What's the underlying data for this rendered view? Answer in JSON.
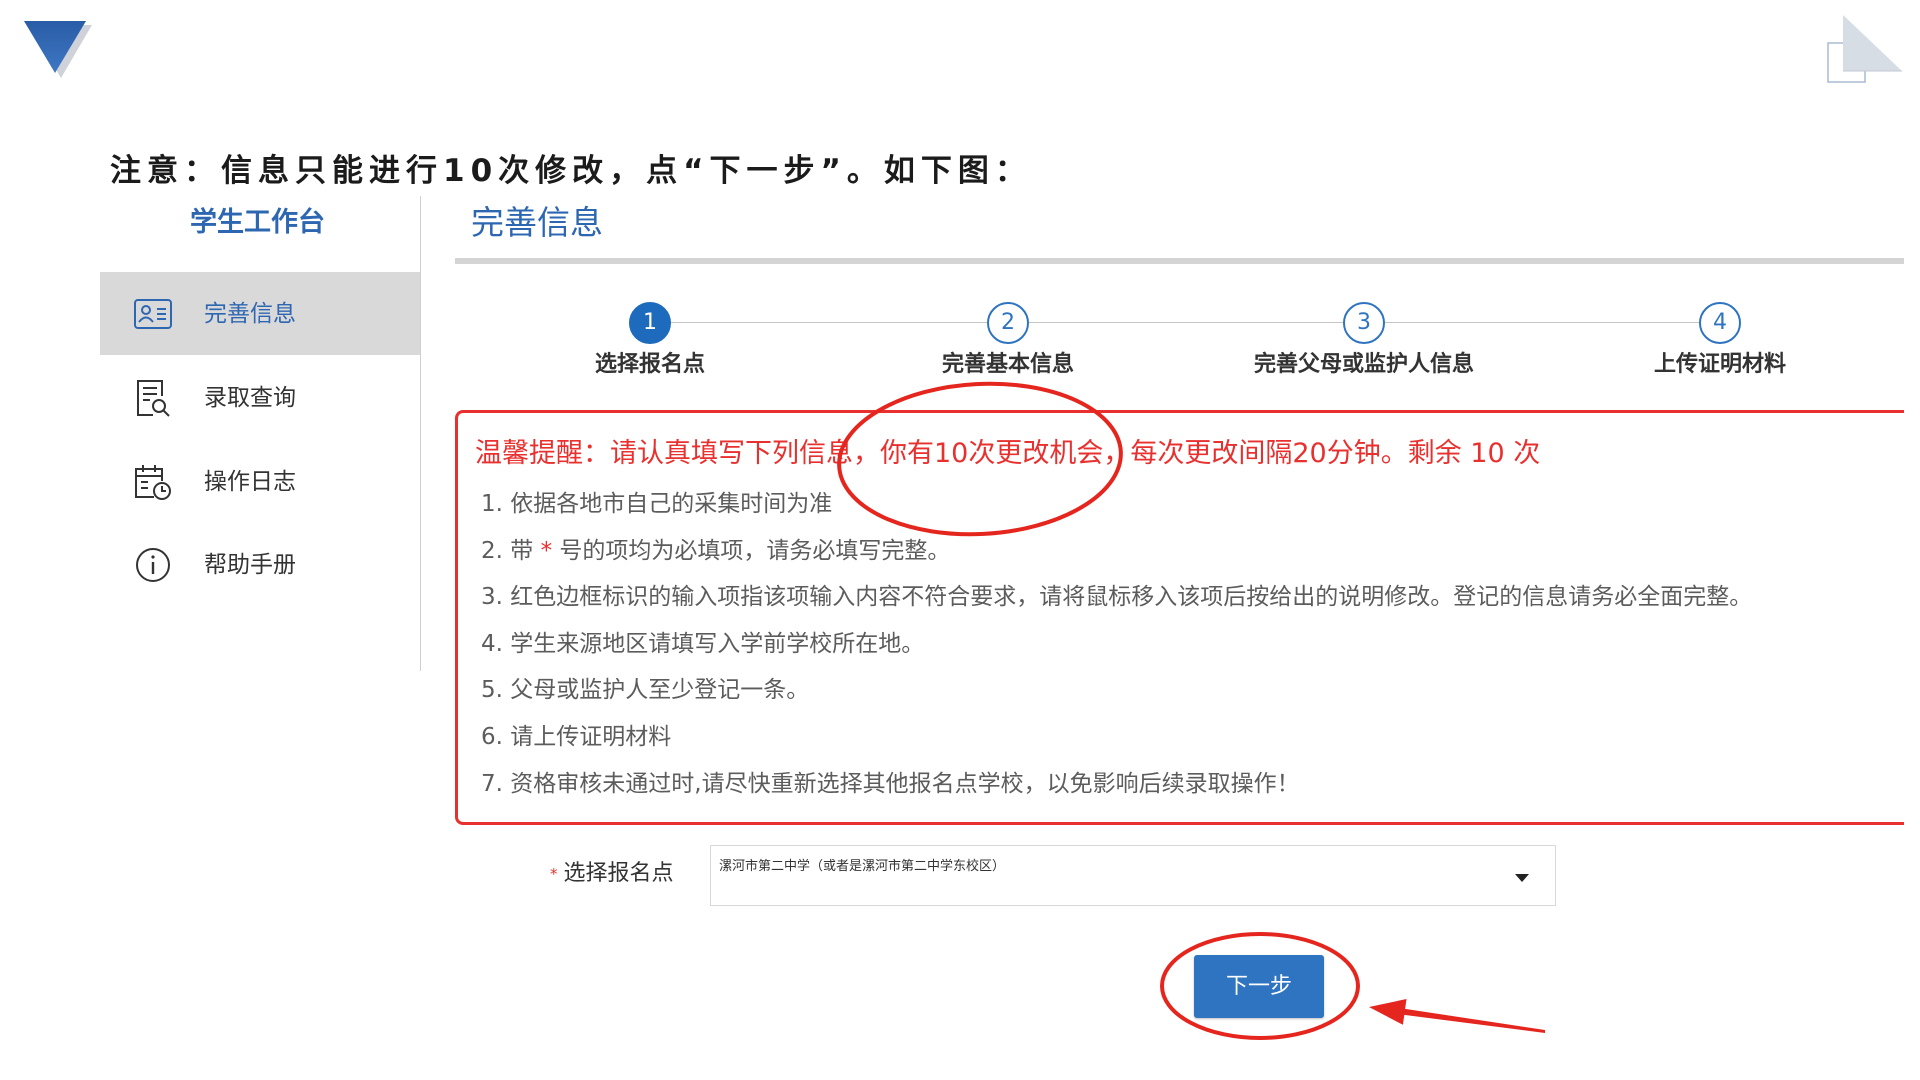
{
  "notice": {
    "heading": "注意：信息只能进行10次修改，点“下一步”。如下图："
  },
  "sidebar": {
    "title": "学生工作台",
    "items": [
      {
        "label": "完善信息",
        "icon": "id-card-icon",
        "active": true
      },
      {
        "label": "录取查询",
        "icon": "document-search-icon",
        "active": false
      },
      {
        "label": "操作日志",
        "icon": "calendar-clock-icon",
        "active": false
      },
      {
        "label": "帮助手册",
        "icon": "info-icon",
        "active": false
      }
    ]
  },
  "main": {
    "title": "完善信息",
    "steps": [
      {
        "number": "1",
        "label": "选择报名点",
        "active": true
      },
      {
        "number": "2",
        "label": "完善基本信息",
        "active": false
      },
      {
        "number": "3",
        "label": "完善父母或监护人信息",
        "active": false
      },
      {
        "number": "4",
        "label": "上传证明材料",
        "active": false
      }
    ],
    "reminder": {
      "title": "温馨提醒：请认真填写下列信息，你有10次更改机会，每次更改间隔20分钟。剩余 10 次",
      "items": [
        {
          "number": "1.",
          "text": "依据各地市自己的采集时间为准"
        },
        {
          "number": "2.",
          "text_before": "带",
          "required_mark": "*",
          "text_after": "号的项均为必填项，请务必填写完整。"
        },
        {
          "number": "3.",
          "text": "红色边框标识的输入项指该项输入内容不符合要求，请将鼠标移入该项后按给出的说明修改。登记的信息请务必全面完整。"
        },
        {
          "number": "4.",
          "text": "学生来源地区请填写入学前学校所在地。"
        },
        {
          "number": "5.",
          "text": "父母或监护人至少登记一条。"
        },
        {
          "number": "6.",
          "text": "请上传证明材料"
        },
        {
          "number": "7.",
          "text": "资格审核未通过时,请尽快重新选择其他报名点学校，以免影响后续录取操作！"
        }
      ]
    },
    "form": {
      "required_mark": "*",
      "label": "选择报名点",
      "selected_value": "漯河市第二中学（或者是漯河市第二中学东校区）"
    },
    "next_button": {
      "label": "下一步"
    }
  },
  "colors": {
    "primary_blue": "#2f74c0",
    "title_blue": "#2e67b1",
    "alert_red": "#e8302f",
    "annotation_red": "#e5261e",
    "sidebar_active_bg": "#d9d9d9",
    "text_gray": "#5c5c5c"
  }
}
